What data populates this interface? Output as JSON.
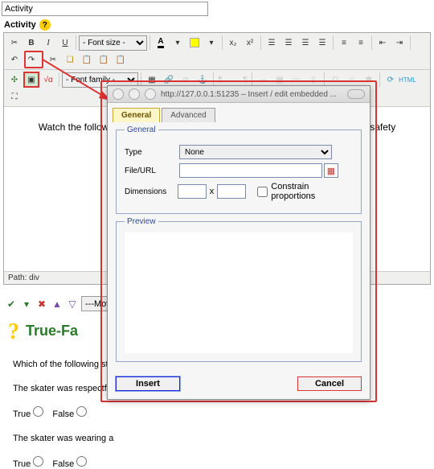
{
  "title_input_value": "Activity",
  "field_label": "Activity",
  "toolbar": {
    "font_size_placeholder": "- Font size -",
    "font_family_placeholder": "- Font family -",
    "bold": "B",
    "italic": "I",
    "underline": "U",
    "sub": "x",
    "sup": "x"
  },
  "editor_content": "Watch the following one-minute skateboarding video and pay attention to any safety concerns:",
  "path_label": "Path:",
  "path_value": "div",
  "move_selected": "---Mov",
  "question": {
    "type_heading": "True-Fa",
    "prompt": "Which of the following sta",
    "stmt1": "The skater was respectfu",
    "stmt2": "The skater was wearing a",
    "true_label": "True",
    "false_label": "False"
  },
  "dialog": {
    "address": "http://127.0.0.1:51235 – Insert / edit embedded ...",
    "tab_general": "General",
    "tab_advanced": "Advanced",
    "legend_general": "General",
    "legend_preview": "Preview",
    "type_label": "Type",
    "type_value": "None",
    "file_label": "File/URL",
    "file_value": "",
    "dim_label": "Dimensions",
    "dim_w": "",
    "dim_h": "",
    "dim_x": "x",
    "constrain_label": "Constrain proportions",
    "btn_insert": "Insert",
    "btn_cancel": "Cancel"
  }
}
